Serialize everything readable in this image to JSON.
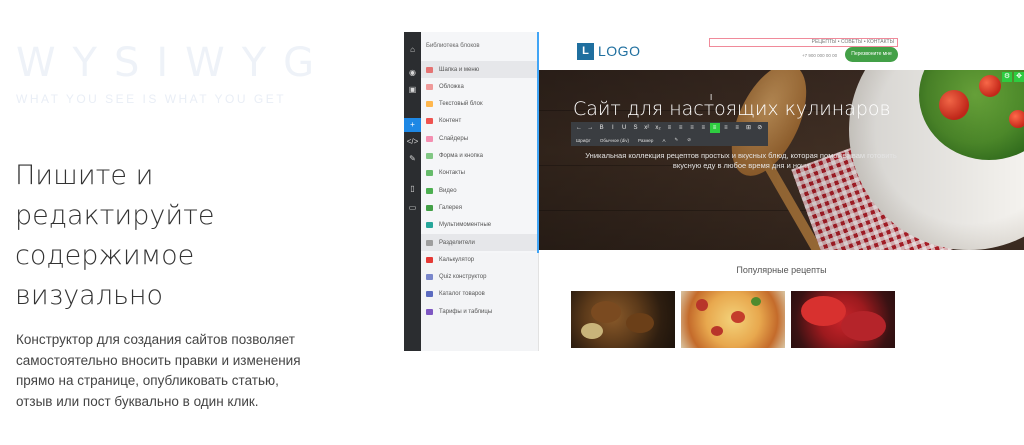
{
  "hero": {
    "brand": "WYSIWYG",
    "brand_sub": "WHAT YOU SEE IS WHAT YOU GET",
    "heading": "Пишите и редактируйте содержимое визуально",
    "description": "Конструктор для создания сайтов позволяет самостоятельно вносить правки и изменения прямо на странице, опубликовать статью, отзыв или пост буквально в один клик."
  },
  "editor": {
    "rail_icons": [
      "home-icon",
      "eye-icon",
      "save-icon",
      "plus-icon",
      "code-icon",
      "brush-icon",
      "mobile-icon",
      "tablet-icon"
    ],
    "library": {
      "title": "Библиотека блоков",
      "items": [
        {
          "label": "Шапка и меню",
          "color": "#e57373"
        },
        {
          "label": "Обложка",
          "color": "#ef9a9a"
        },
        {
          "label": "Текстовый блок",
          "color": "#ffb74d"
        },
        {
          "label": "Контент",
          "color": "#ef5350"
        },
        {
          "label": "Слайдеры",
          "color": "#f48fb1"
        },
        {
          "label": "Форма и кнопка",
          "color": "#81c784"
        },
        {
          "label": "Контакты",
          "color": "#66bb6a"
        },
        {
          "label": "Видео",
          "color": "#4caf50"
        },
        {
          "label": "Галерея",
          "color": "#43a047"
        },
        {
          "label": "Мультимоментные",
          "color": "#26a69a"
        },
        {
          "label": "Разделители",
          "color": "#9e9e9e"
        },
        {
          "label": "Калькулятор",
          "color": "#e53935"
        },
        {
          "label": "Quiz конструктор",
          "color": "#7986cb"
        },
        {
          "label": "Каталог товаров",
          "color": "#5c6bc0"
        },
        {
          "label": "Тарифы и таблицы",
          "color": "#7e57c2"
        }
      ]
    }
  },
  "site": {
    "logo_letter": "L",
    "logo_text": "LOGO",
    "nav": "РЕЦЕПТЫ • СОВЕТЫ • КОНТАКТЫ",
    "phone": "+7 900 000 00 00",
    "cta": "Перезвоните мне",
    "banner": {
      "title": "Сайт для настоящих кулинаров",
      "subtitle": "Уникальная коллекция рецептов простых и вкусных блюд, которая поможет вам готовить вкусную еду в любое время дня и ночи",
      "toolbar_row1": [
        "←",
        "→",
        "B",
        "I",
        "U",
        "S",
        "x²",
        "x₂",
        "≡",
        "≡",
        "≡",
        "≡",
        "≡",
        "≡",
        "≡",
        "⊞",
        "⊘"
      ],
      "toolbar_active_index": 12,
      "toolbar_row2": [
        "Шрифт",
        "Обычное (div)",
        "Размер",
        "A",
        "✎",
        "⊘"
      ]
    },
    "section_title": "Популярные рецепты"
  },
  "colors": {
    "accent_green": "#43a047",
    "logo_blue": "#1f6f9f",
    "rail_dark": "#2b2d30",
    "highlight_blue": "#1e88e5"
  }
}
